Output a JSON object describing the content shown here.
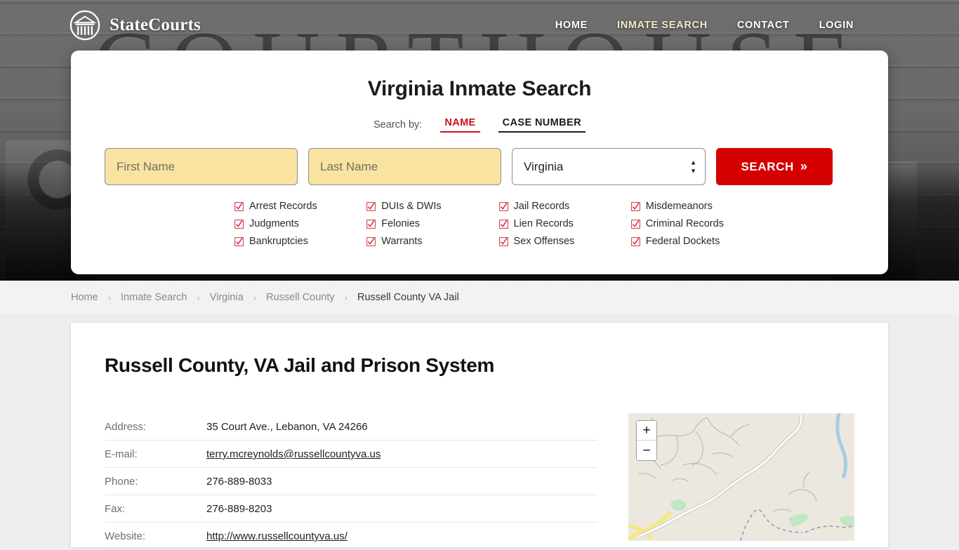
{
  "brand": {
    "name": "StateCourts",
    "logo_icon": "courthouse-circle-icon"
  },
  "nav": [
    {
      "label": "HOME",
      "active": false
    },
    {
      "label": "INMATE SEARCH",
      "active": true
    },
    {
      "label": "CONTACT",
      "active": false
    },
    {
      "label": "LOGIN",
      "active": false
    }
  ],
  "hero": {
    "background_word": "COURTHOUSE"
  },
  "search": {
    "title": "Virginia Inmate Search",
    "search_by_label": "Search by:",
    "tabs": [
      {
        "label": "NAME",
        "active": true
      },
      {
        "label": "CASE NUMBER",
        "active": false
      }
    ],
    "first_name_placeholder": "First Name",
    "first_name_value": "",
    "last_name_placeholder": "Last Name",
    "last_name_value": "",
    "state_selected": "Virginia",
    "state_options": [
      "Virginia"
    ],
    "button_label": "SEARCH",
    "button_chevron": "»",
    "accent_red": "#d40000",
    "tab_active_red": "#c9131a",
    "input_fill": "#f9e3a0",
    "categories": [
      "Arrest Records",
      "DUIs & DWIs",
      "Jail Records",
      "Misdemeanors",
      "Judgments",
      "Felonies",
      "Lien Records",
      "Criminal Records",
      "Bankruptcies",
      "Warrants",
      "Sex Offenses",
      "Federal Dockets"
    ]
  },
  "breadcrumb": {
    "separator": "›",
    "items": [
      {
        "label": "Home",
        "current": false
      },
      {
        "label": "Inmate Search",
        "current": false
      },
      {
        "label": "Virginia",
        "current": false
      },
      {
        "label": "Russell County",
        "current": false
      },
      {
        "label": "Russell County VA Jail",
        "current": true
      }
    ]
  },
  "main": {
    "title": "Russell County, VA Jail and Prison System",
    "details": [
      {
        "label": "Address:",
        "value": "35 Court Ave., Lebanon, VA 24266",
        "link": false
      },
      {
        "label": "E-mail:",
        "value": "terry.mcreynolds@russellcountyva.us",
        "link": true
      },
      {
        "label": "Phone:",
        "value": "276-889-8033",
        "link": false
      },
      {
        "label": "Fax:",
        "value": "276-889-8203",
        "link": false
      },
      {
        "label": "Website:",
        "value": "http://www.russellcountyva.us/",
        "link": true
      }
    ]
  },
  "map": {
    "zoom_in_label": "+",
    "zoom_out_label": "−",
    "land_color": "#ece8e0",
    "water_color": "#a5cfe0",
    "highway_color": "#f5e98f",
    "green_color": "#c4e5c0"
  }
}
